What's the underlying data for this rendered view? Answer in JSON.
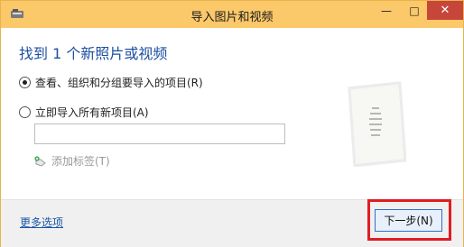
{
  "window": {
    "title": "导入图片和视频",
    "minimize_glyph": "—",
    "maximize_glyph": "□",
    "close_glyph": "✕"
  },
  "main": {
    "heading": "找到 1 个新照片或视频",
    "option_review": "查看、组织和分组要导入的项目(R)",
    "option_import_all": "立即导入所有新项目(A)",
    "tag_input_value": "",
    "add_tag_label": "添加标签(T)"
  },
  "footer": {
    "more_options": "更多选项",
    "next_button": "下一步(N)"
  },
  "state": {
    "selected_option": "review"
  },
  "icons": {
    "app": "scanner-camera-icon",
    "tag": "tag-add-icon",
    "photo": "photo-preview-thumbnail"
  },
  "colors": {
    "titlebar": "#fbc86a",
    "heading": "#1c4fa0",
    "link": "#1a56a8",
    "close": "#c7463a",
    "highlight": "#e11b22"
  }
}
